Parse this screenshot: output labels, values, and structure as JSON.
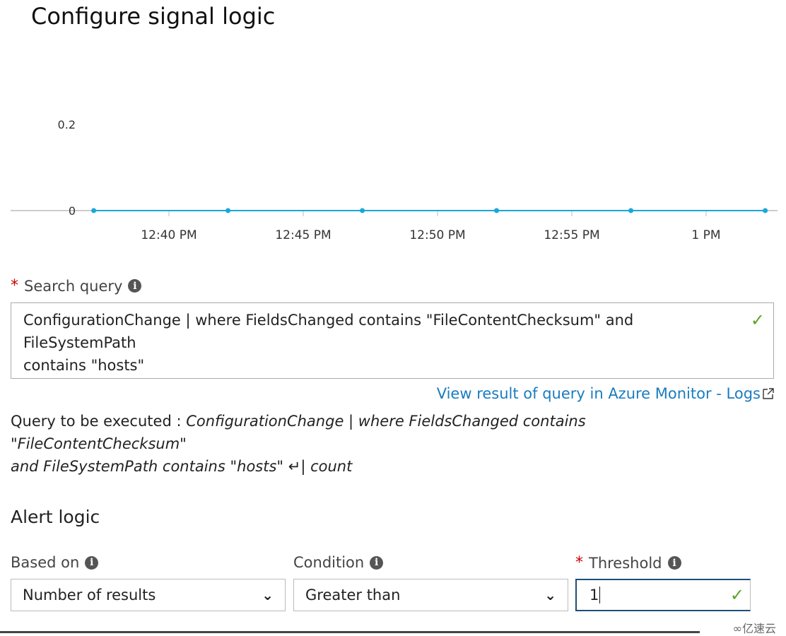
{
  "title": "Configure signal logic",
  "chart_data": {
    "type": "line",
    "title": "",
    "xlabel": "",
    "ylabel": "",
    "y_ticks": [
      "0.2",
      "0"
    ],
    "y_tick_values": [
      0.2,
      0
    ],
    "x_ticks": [
      "12:40 PM",
      "12:45 PM",
      "12:50 PM",
      "12:55 PM",
      "1 PM"
    ],
    "x_tick_minutes": [
      40,
      45,
      50,
      55,
      60
    ],
    "x": [
      "12:37 PM",
      "12:42 PM",
      "12:47 PM",
      "12:52 PM",
      "12:57 PM",
      "1:02 PM"
    ],
    "x_minutes": [
      37.2,
      42.2,
      47.2,
      52.2,
      57.2,
      62.2
    ],
    "values": [
      0,
      0,
      0,
      0,
      0,
      0
    ],
    "line_color": "#1aa7d9",
    "grid": false
  },
  "search": {
    "label": "Search query",
    "value_line1": "ConfigurationChange | where FieldsChanged contains \"FileContentChecksum\" and FileSystemPath",
    "value_line2": "contains \"hosts\"",
    "valid_icon": "check-icon"
  },
  "logs_link": "View result of query in Azure Monitor - Logs",
  "exec": {
    "prefix": "Query to be executed : ",
    "query_line1": "ConfigurationChange | where FieldsChanged contains \"FileContentChecksum\"",
    "query_line2": "and FileSystemPath contains \"hosts\" ↵| count"
  },
  "alert": {
    "title": "Alert logic",
    "based_on_label": "Based on",
    "based_on_value": "Number of results",
    "condition_label": "Condition",
    "condition_value": "Greater than",
    "threshold_label": "Threshold",
    "threshold_value": "1"
  },
  "watermark": "亿速云",
  "colors": {
    "accent": "#1a7cc0",
    "required": "#cc0000",
    "valid": "#5ea324"
  }
}
